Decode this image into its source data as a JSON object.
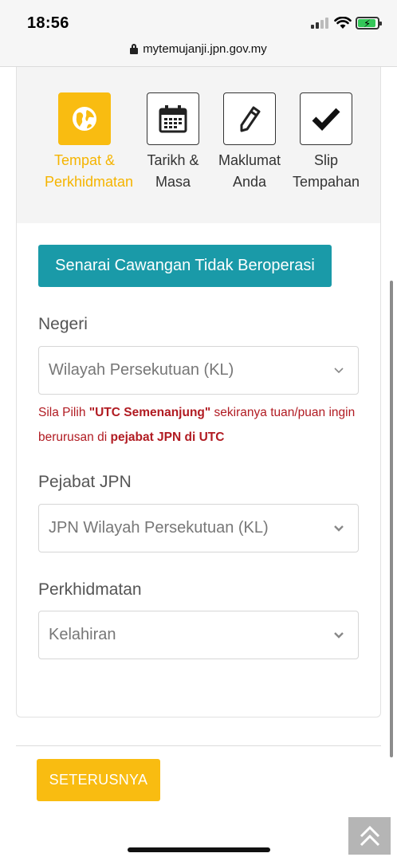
{
  "status_bar": {
    "time": "18:56"
  },
  "browser": {
    "url": "mytemujanji.jpn.gov.my"
  },
  "steps": [
    {
      "label_line1": "Tempat &",
      "label_line2": "Perkhidmatan",
      "icon": "globe-icon",
      "active": true
    },
    {
      "label_line1": "Tarikh &",
      "label_line2": "Masa",
      "icon": "calendar-icon",
      "active": false
    },
    {
      "label_line1": "Maklumat",
      "label_line2": "Anda",
      "icon": "pencil-icon",
      "active": false
    },
    {
      "label_line1": "Slip",
      "label_line2": "Tempahan",
      "icon": "checkmark-icon",
      "active": false
    }
  ],
  "branch_button": {
    "label": "Senarai Cawangan Tidak Beroperasi"
  },
  "negeri": {
    "label": "Negeri",
    "value": "Wilayah Persekutuan (KL)"
  },
  "hint": {
    "part1": "Sila Pilih ",
    "bold1": "\"UTC Semenanjung\"",
    "part2": " sekiranya tuan/puan ingin berurusan di ",
    "bold2": "pejabat JPN di UTC"
  },
  "pejabat": {
    "label": "Pejabat JPN",
    "value": "JPN Wilayah Persekutuan (KL)"
  },
  "perkhidmatan": {
    "label": "Perkhidmatan",
    "value": "Kelahiran"
  },
  "next_button": {
    "label": "SETERUSNYA"
  },
  "colors": {
    "accent": "#f9bc11",
    "teal": "#1a9aa8",
    "error": "#b11b22"
  }
}
